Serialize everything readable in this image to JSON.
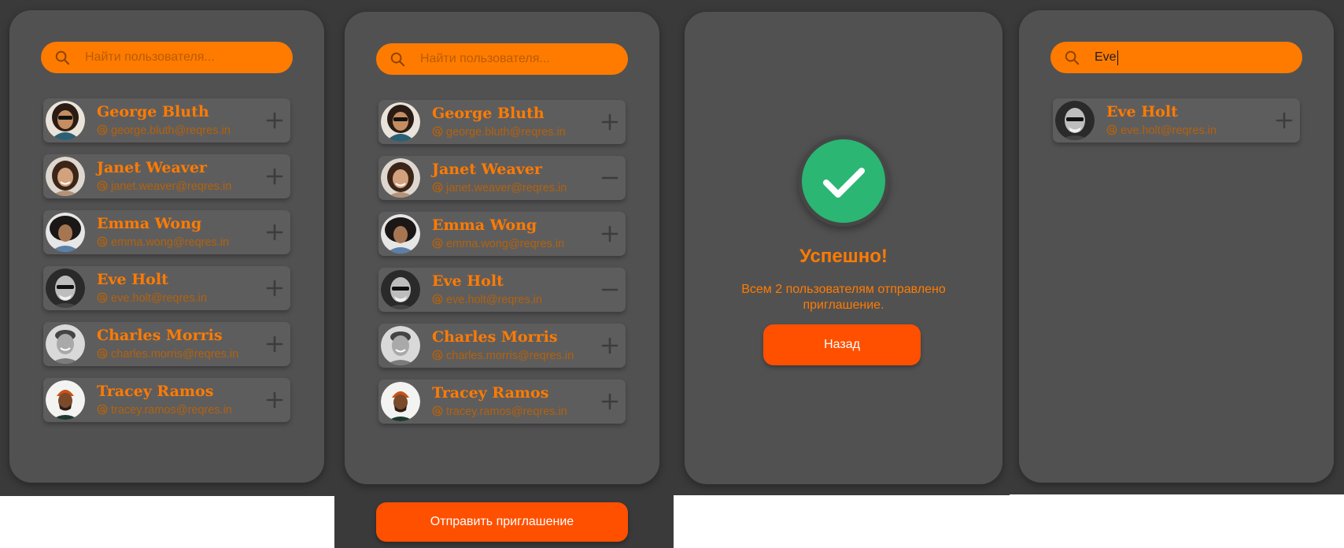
{
  "users": [
    {
      "name": "George Bluth",
      "email": "george.bluth@reqres.in",
      "avatar": "avatar-george"
    },
    {
      "name": "Janet Weaver",
      "email": "janet.weaver@reqres.in",
      "avatar": "avatar-janet"
    },
    {
      "name": "Emma Wong",
      "email": "emma.wong@reqres.in",
      "avatar": "avatar-emma"
    },
    {
      "name": "Eve Holt",
      "email": "eve.holt@reqres.in",
      "avatar": "avatar-eve"
    },
    {
      "name": "Charles Morris",
      "email": "charles.morris@reqres.in",
      "avatar": "avatar-charles"
    },
    {
      "name": "Tracey Ramos",
      "email": "tracey.ramos@reqres.in",
      "avatar": "avatar-tracey"
    }
  ],
  "search": {
    "placeholder": "Найти пользователя...",
    "filter_value": "Eve"
  },
  "send_button": "Отправить приглашение",
  "success": {
    "title": "Успешно!",
    "message": "Всем 2 пользователям отправлено приглашение.",
    "back": "Назад"
  },
  "colors": {
    "accent": "#ff7b00",
    "button": "#ff5000",
    "success": "#2bb673",
    "card": "#525152",
    "background": "#3a3a3b"
  },
  "icons": {
    "search": "search-icon",
    "add": "plus-icon",
    "remove": "minus-icon",
    "email": "at-sign-icon",
    "check": "check-icon"
  }
}
